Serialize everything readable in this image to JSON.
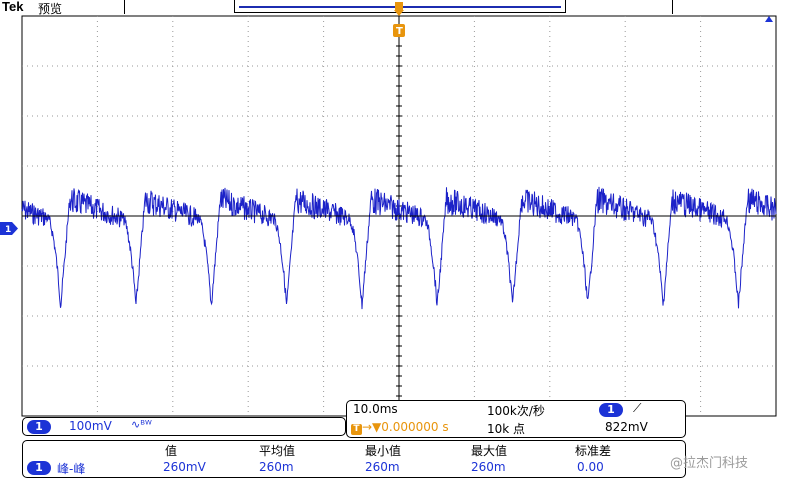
{
  "header": {
    "brand": "Tek",
    "mode": "预览"
  },
  "channel": {
    "number": "1",
    "scale": "100mV",
    "bandwidth_symbol": "∿ᴮᵂ",
    "color": "#1c33d6"
  },
  "timebase": {
    "scale": "10.0ms",
    "sample_rate": "100k次/秒",
    "trigger_position": "0.000000 s",
    "record_length": "10k 点"
  },
  "trigger": {
    "source": "1",
    "slope_symbol": "⟋",
    "level": "822mV",
    "marker_label": "T",
    "color": "#e8950d"
  },
  "measurements": {
    "headers": [
      "值",
      "平均值",
      "最小值",
      "最大值",
      "标准差"
    ],
    "rows": [
      {
        "channel": "1",
        "name": "峰-峰",
        "values": [
          "260mV",
          "260m",
          "260m",
          "260m",
          "0.00"
        ]
      }
    ]
  },
  "watermark": "@拉杰门科技"
}
